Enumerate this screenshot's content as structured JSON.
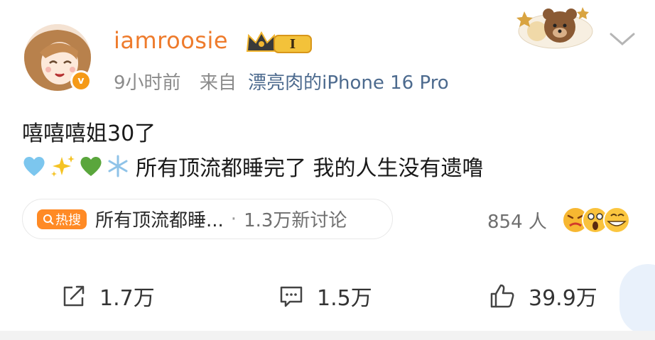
{
  "post": {
    "username": "iamroosie",
    "level_badge": "I",
    "verified_badge": "v",
    "time": "9小时前",
    "source_prefix": "来自",
    "source": "漂亮肉的iPhone 16 Pro",
    "line1": "嘻嘻嘻姐30了",
    "line2_emojis": [
      "blue-heart",
      "sparkles",
      "green-heart",
      "snowflake"
    ],
    "line2_text": "所有顶流都睡完了 我的人生没有遗噜"
  },
  "hot_topic": {
    "badge": "热搜",
    "title": "所有顶流都睡...",
    "separator": "·",
    "count": "1.3万新讨论"
  },
  "reactions": {
    "people": "854 人",
    "faces": [
      "angry-face",
      "shocked-face",
      "grin-face"
    ]
  },
  "actions": {
    "repost": "1.7万",
    "comment": "1.5万",
    "like": "39.9万"
  },
  "icons": {
    "repost": "repost-icon",
    "comment": "comment-icon",
    "like": "thumbs-up-icon",
    "menu": "chevron-down-icon"
  },
  "colors": {
    "username": "#ee7b2c",
    "meta_gray": "#8b8b8b",
    "source_blue": "#4c6a8e",
    "hot_orange": "#ff8a25"
  }
}
